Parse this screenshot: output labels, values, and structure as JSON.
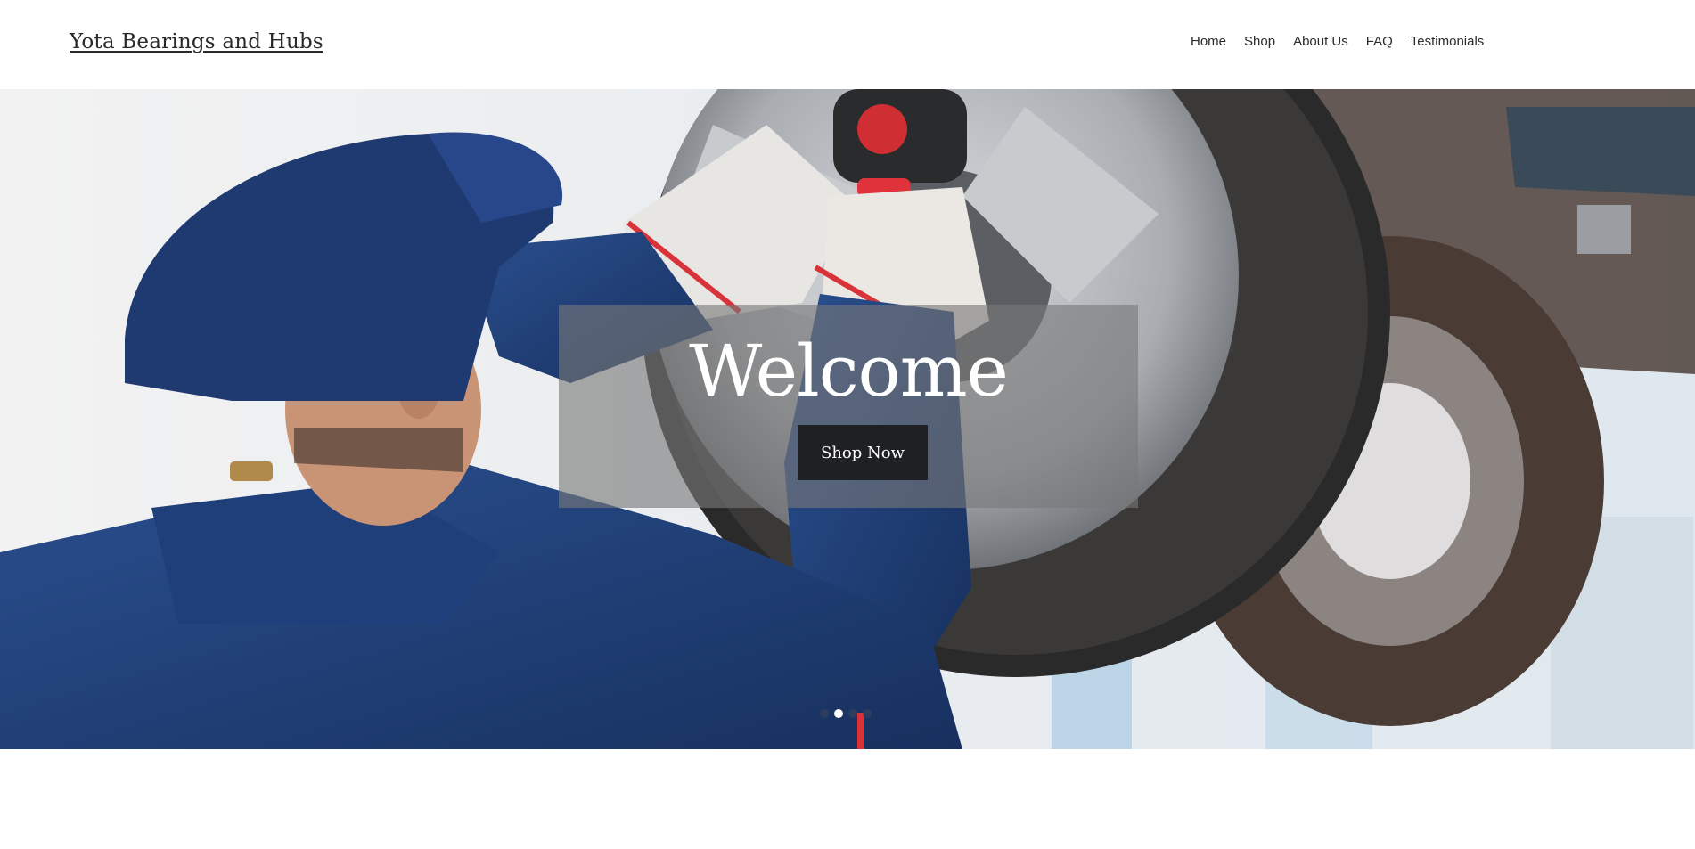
{
  "site": {
    "title": "Yota Bearings and Hubs"
  },
  "nav": {
    "items": [
      "Home",
      "Shop",
      "About Us",
      "FAQ",
      "Testimonials"
    ]
  },
  "hero": {
    "heading": "Welcome",
    "cta_label": "Shop Now",
    "slides": {
      "count": 4,
      "active_index": 1
    },
    "image": "mechanic-wheel-photo"
  },
  "colors": {
    "button_bg": "#1f2024",
    "overlay": "rgba(120,120,120,0.62)",
    "uniform_blue": "#1e3f7a"
  }
}
